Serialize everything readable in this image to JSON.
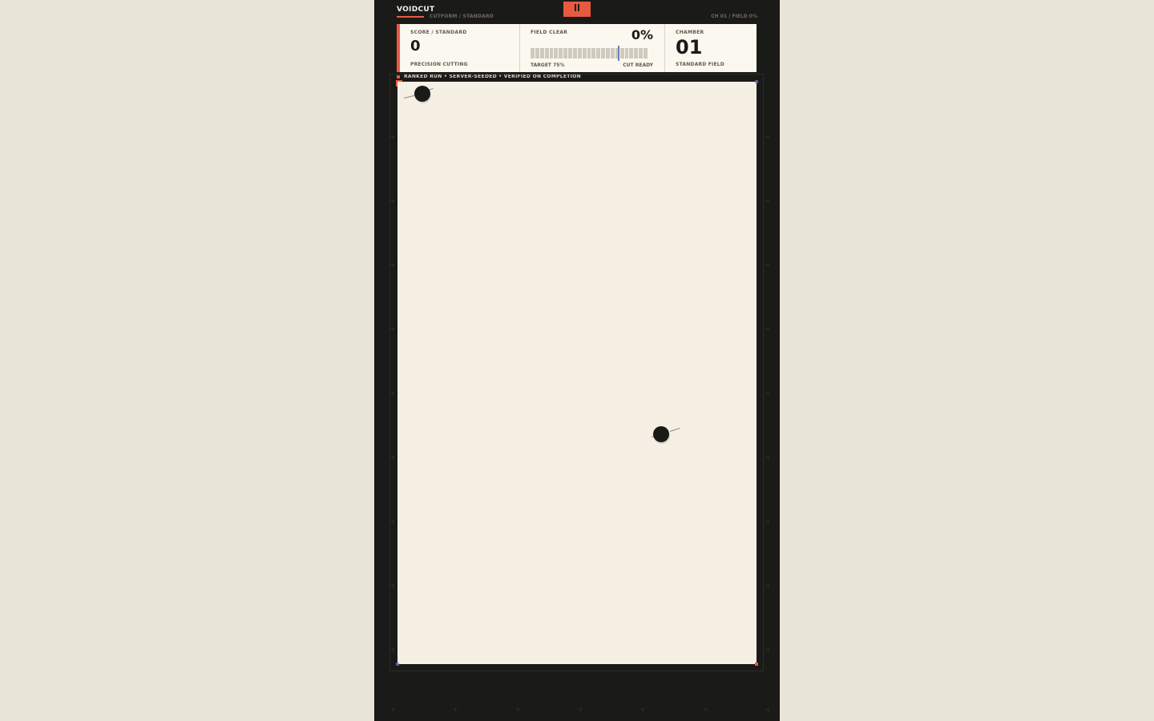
{
  "app": {
    "title": "VOIDCUT",
    "subtitle": "CUTFORM / STANDARD",
    "status": "CH 01 / FIELD 0%"
  },
  "colors": {
    "accent": "#e85a40",
    "dark": "#1a1a18",
    "arena": "#f6efe4",
    "panel": "#fbf8ef",
    "target": "#6b7fb8"
  },
  "icons": {
    "pause": "pause-icon"
  },
  "hud": {
    "score": {
      "label": "SCORE / STANDARD",
      "value": "0",
      "foot": "PRECISION CUTTING"
    },
    "field": {
      "label": "FIELD CLEAR",
      "value": "0%",
      "progress": 0,
      "target": 0.75,
      "target_label": "TARGET 75%",
      "status": "CUT READY"
    },
    "chamber": {
      "label": "CHAMBER",
      "value": "01",
      "foot": "STANDARD FIELD"
    }
  },
  "ticker": "RANKED RUN • SERVER-SEEDED • VERIFIED ON COMPLETION"
}
